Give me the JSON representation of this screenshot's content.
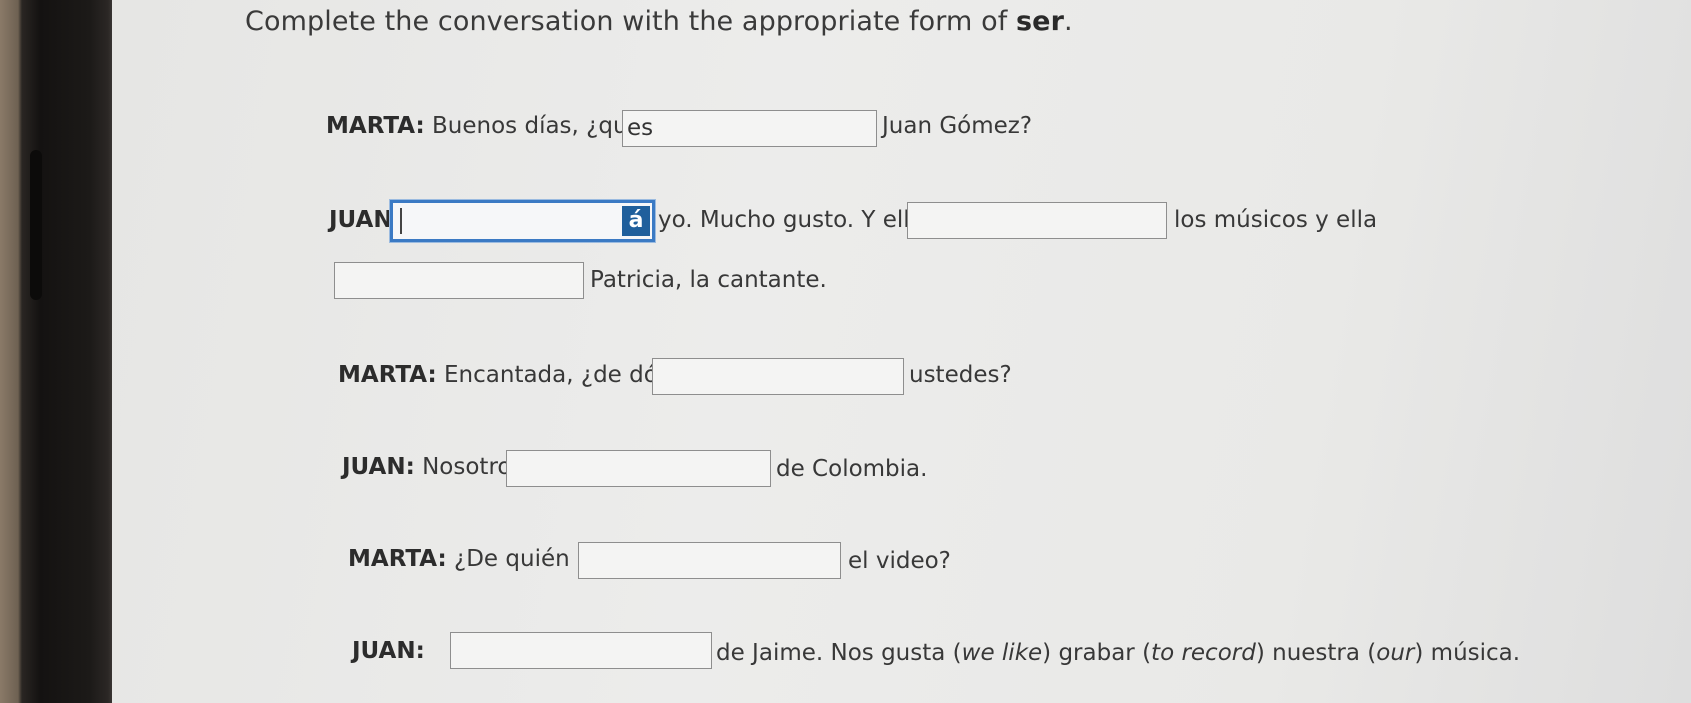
{
  "instruction": {
    "prefix": "Complete the conversation with the appropriate form of ",
    "verb": "ser",
    "suffix": "."
  },
  "conversation": [
    {
      "speaker": "MARTA:",
      "before": "Buenos días, ¿quién",
      "answer": "es",
      "after": "Juan Gómez?"
    },
    {
      "speaker": "JUAN:",
      "before": "",
      "answer": "",
      "after": "yo. Mucho gusto. Y ellos"
    },
    {
      "speaker": "",
      "before": "",
      "answer": "",
      "after": "los músicos y ella"
    },
    {
      "speaker": "",
      "before": "",
      "answer": "",
      "after": "Patricia, la cantante."
    },
    {
      "speaker": "MARTA:",
      "before": "Encantada, ¿de dónde",
      "answer": "",
      "after": "ustedes?"
    },
    {
      "speaker": "JUAN:",
      "before": "Nosotros",
      "answer": "",
      "after": "de Colombia."
    },
    {
      "speaker": "MARTA:",
      "before": "¿De quién",
      "answer": "",
      "after": "el video?"
    },
    {
      "speaker": "JUAN:",
      "before": "",
      "answer": "",
      "after": "de Jaime. Nos gusta ("
    }
  ],
  "last_line_tail": {
    "we_like": "we like",
    "mid1": ") grabar (",
    "to_record": "to record",
    "mid2": ") nuestra (",
    "our": "our",
    "end": ") música."
  },
  "accent_button": {
    "label": "á"
  }
}
